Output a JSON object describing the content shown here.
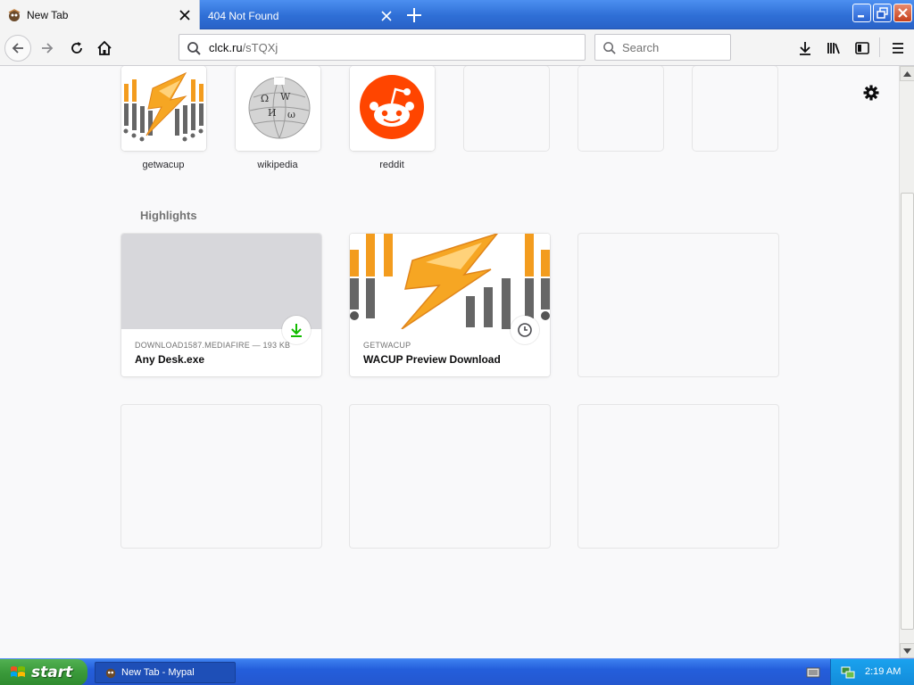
{
  "tabs": [
    {
      "label": "New Tab",
      "active": true
    },
    {
      "label": "404 Not Found",
      "active": false
    }
  ],
  "navbar": {
    "url_domain": "clck.ru",
    "url_path": "/sTQXj",
    "search_placeholder": "Search"
  },
  "top_sites": [
    {
      "label": "getwacup",
      "icon": "wacup-logo"
    },
    {
      "label": "wikipedia",
      "icon": "wikipedia-globe"
    },
    {
      "label": "reddit",
      "icon": "reddit-alien"
    },
    {
      "label": "",
      "icon": ""
    },
    {
      "label": "",
      "icon": ""
    },
    {
      "label": "",
      "icon": ""
    }
  ],
  "highlights": {
    "title": "Highlights",
    "cards": [
      {
        "source": "DOWNLOAD1587.MEDIAFIRE — 193 KB",
        "title": "Any Desk.exe",
        "badge": "download-icon"
      },
      {
        "source": "GETWACUP",
        "title": "WACUP Preview Download",
        "badge": "clock-icon"
      }
    ]
  },
  "taskbar": {
    "start_label": "start",
    "task_label": "New Tab - Mypal",
    "clock": "2:19 AM"
  },
  "colors": {
    "reddit": "#ff4500",
    "download_green": "#12bc00",
    "xp_blue": "#245edb",
    "start_green": "#3a9a3a"
  }
}
